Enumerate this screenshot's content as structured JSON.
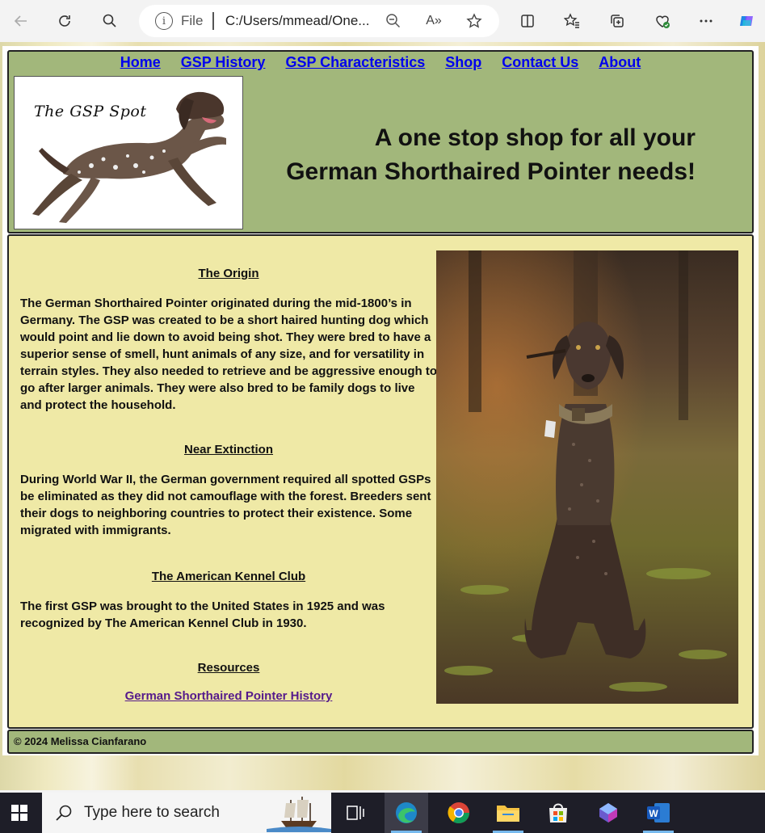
{
  "browser": {
    "file_label": "File",
    "url": "C:/Users/mmead/One...",
    "read_aloud_label": "A»"
  },
  "nav": {
    "items": [
      {
        "label": "Home"
      },
      {
        "label": "GSP History"
      },
      {
        "label": "GSP Characteristics"
      },
      {
        "label": "Shop"
      },
      {
        "label": "Contact Us"
      },
      {
        "label": "About"
      }
    ]
  },
  "header": {
    "logo_text": "The GSP Spot",
    "tagline_line1": "A one stop shop for all your",
    "tagline_line2": "German Shorthaired Pointer needs!"
  },
  "sections": [
    {
      "title": "The Origin",
      "text": "The German Shorthaired Pointer originated during the mid-1800’s in Germany. The GSP was created to be a short haired hunting dog which would point and lie down to avoid being shot. They were bred to have a superior sense of smell, hunt animals of any size, and for versatility in terrain styles. They also needed to retrieve and be aggressive enough to go after larger animals. They were also bred to be family dogs to live and protect the household."
    },
    {
      "title": "Near Extinction",
      "text": "During World War II, the German government required all spotted GSPs be eliminated as they did not camouflage with the forest. Breeders sent their dogs to neighboring countries to protect their existence. Some migrated with immigrants."
    },
    {
      "title": "The American Kennel Club",
      "text": "The first GSP was brought to the United States in 1925 and was recognized by The American Kennel Club in 1930."
    }
  ],
  "resources": {
    "title": "Resources",
    "link_label": "German Shorthaired Pointer History"
  },
  "footer": {
    "copyright": "© 2024 Melissa Cianfarano"
  },
  "taskbar": {
    "search_placeholder": "Type here to search",
    "apps": [
      "task-view",
      "edge",
      "chrome",
      "file-explorer",
      "microsoft-store",
      "copilot",
      "word"
    ]
  },
  "colors": {
    "header_bg": "#a2b77b",
    "content_bg": "#efe9a6",
    "link": "#0000ee",
    "visited_link": "#551a8b"
  }
}
